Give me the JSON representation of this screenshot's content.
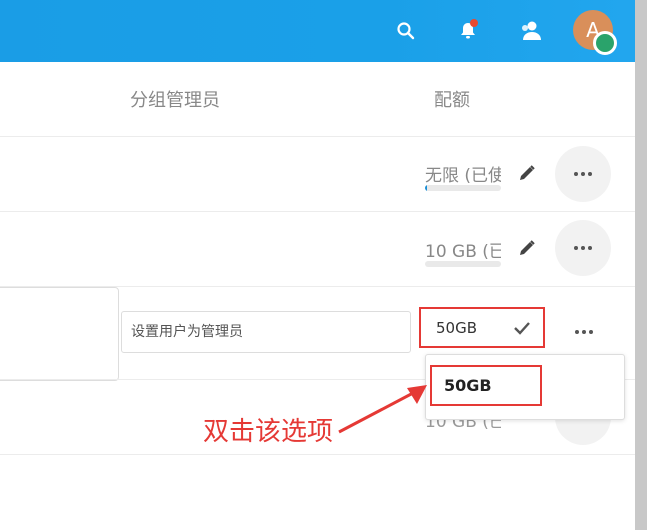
{
  "table": {
    "headers": {
      "group_admin": "分组管理员",
      "quota": "配额"
    },
    "rows": [
      {
        "quota_text": "无限 (已使",
        "usage_fraction": 0.02
      },
      {
        "quota_text": "10 GB (已",
        "usage_fraction": 0.0
      },
      {
        "admin_placeholder": "设置用户为管理员",
        "quota_value": "50GB"
      },
      {
        "quota_text": "10 GB (已"
      }
    ]
  },
  "dropdown": {
    "options": [
      "50GB"
    ]
  },
  "annotation": {
    "text": "双击该选项"
  },
  "colors": {
    "header": "#1a9de6",
    "annotation": "#e53935",
    "avatar": "#d98f5a",
    "status": "#2aa36b"
  },
  "avatar": {
    "initial": "A"
  }
}
